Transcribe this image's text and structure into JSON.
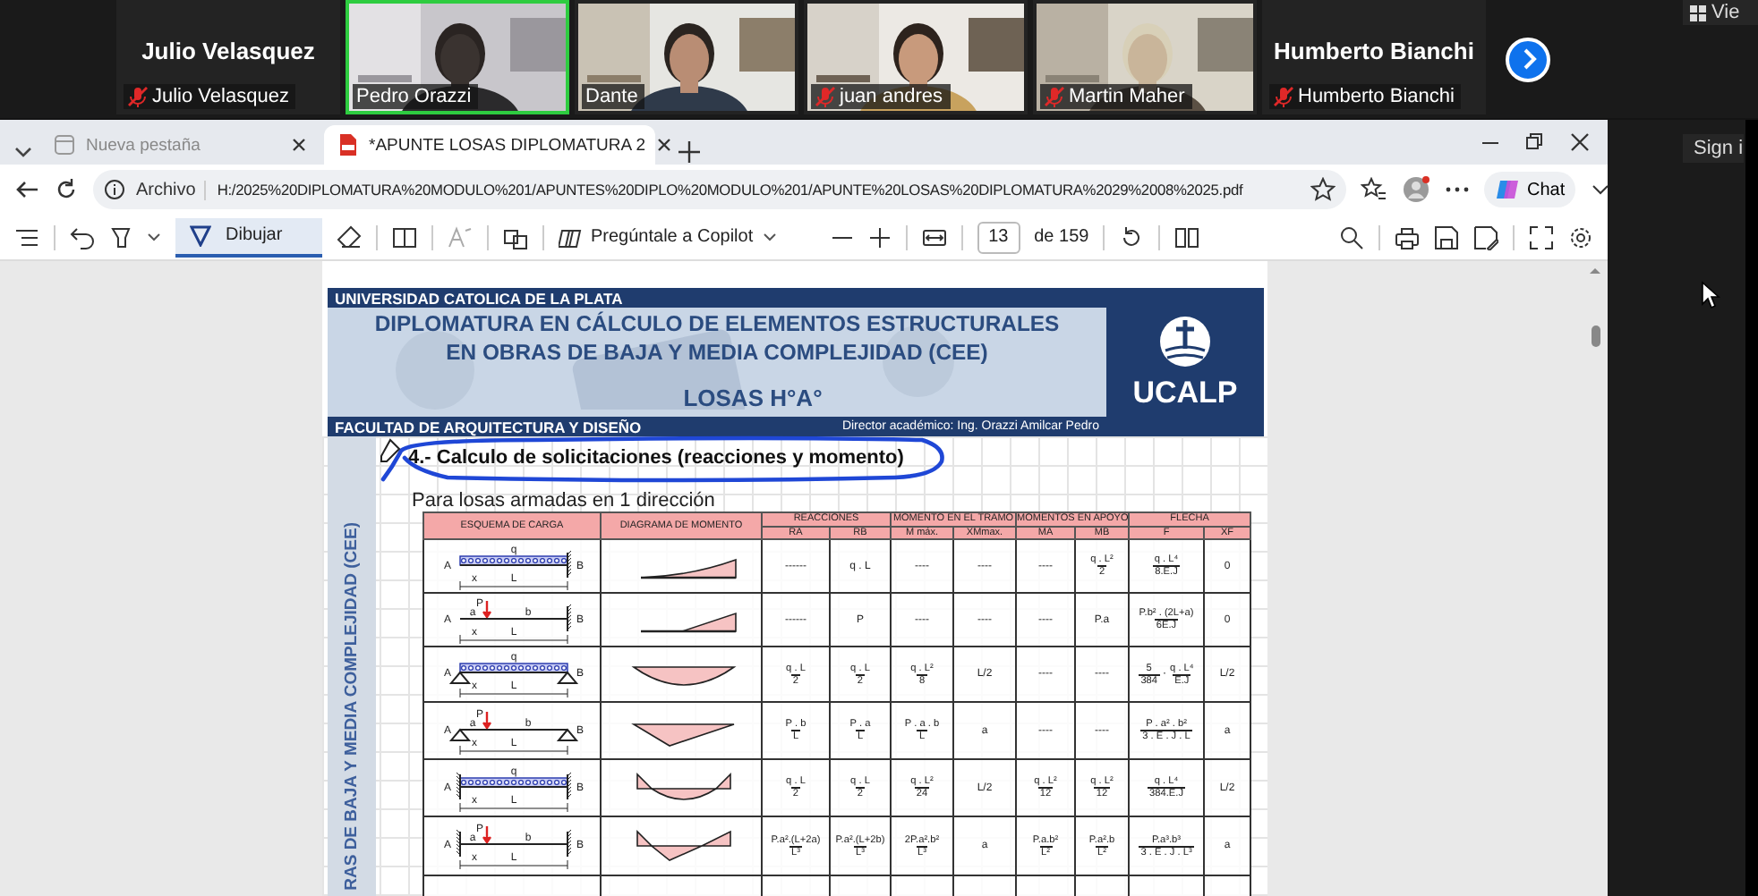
{
  "meeting": {
    "participants": [
      {
        "kind": "name",
        "tile_name": "Julio Velasquez",
        "name": "Julio Velasquez",
        "muted": true,
        "speaking": false
      },
      {
        "kind": "video",
        "name": "Pedro Orazzi",
        "muted": false,
        "speaking": true
      },
      {
        "kind": "video",
        "name": "Dante",
        "muted": false,
        "speaking": false
      },
      {
        "kind": "video",
        "name": "juan andres",
        "muted": true,
        "speaking": false
      },
      {
        "kind": "video",
        "name": "Martin Maher",
        "muted": true,
        "speaking": false
      },
      {
        "kind": "name",
        "tile_name": "Humberto Bianchi",
        "name": "Humberto Bianchi",
        "muted": true,
        "speaking": false
      }
    ],
    "view_label": "Vie",
    "sign_in_label": "Sign i"
  },
  "browser": {
    "tabs": [
      {
        "title": "Nueva pestaña",
        "selected": false
      },
      {
        "title": "*APUNTE LOSAS DIPLOMATURA 2",
        "selected": true
      }
    ],
    "address": {
      "prefix": "Archivo",
      "url": "H:/2025%20DIPLOMATURA%20MODULO%201/APUNTES%20DIPLO%20MODULO%201/APUNTE%20LOSAS%20DIPLOMATURA%2029%2008%2025.pdf"
    },
    "chat_label": "Chat",
    "toolbar": {
      "draw": {
        "label": "Dibujar",
        "selected": true
      },
      "copilot_label": "Pregúntale a Copilot",
      "page": "13",
      "page_count": "de 159"
    }
  },
  "document": {
    "university": "UNIVERSIDAD CATOLICA DE LA PLATA",
    "title_lines": [
      "DIPLOMATURA EN CÁLCULO DE ELEMENTOS ESTRUCTURALES",
      "EN OBRAS DE BAJA Y MEDIA COMPLEJIDAD (CEE)"
    ],
    "subject": "LOSAS H°A°",
    "faculty": "FACULTAD DE ARQUITECTURA Y DISEÑO",
    "director": "Director académico: Ing. Orazzi Amilcar Pedro",
    "logo_text": "UCALP",
    "side_text": "RAS DE BAJA Y MEDIA COMPLEJIDAD (CEE)",
    "heading": "4.- Calculo de solicitaciones (reacciones y momento)",
    "intro": "Para losas armadas en 1 dirección",
    "table": {
      "columns": [
        {
          "label": "ESQUEMA DE CARGA"
        },
        {
          "label": "DIAGRAMA DE MOMENTO"
        },
        {
          "label": "REACCIONES",
          "sub": [
            "RA",
            "RB"
          ]
        },
        {
          "label": "MOMENTO EN EL TRAMO",
          "sub": [
            "M máx.",
            "XMmax."
          ]
        },
        {
          "label": "MOMENTOS EN APOYO",
          "sub": [
            "MA",
            "MB"
          ]
        },
        {
          "label": "FLECHA",
          "sub": [
            "F",
            "XF"
          ]
        }
      ],
      "rows": [
        {
          "scheme": {
            "kind": "cantilever_udl",
            "load_label": "q",
            "ends": [
              "A",
              "B"
            ],
            "bottom_dims": [
              "x",
              "L"
            ]
          },
          "moment": {
            "kind": "cantilever_udl"
          },
          "values": [
            "------",
            "q . L",
            "----",
            "----",
            "----",
            [
              {
                "num": "q . L²",
                "den": "2"
              }
            ],
            [
              {
                "num": "q . L⁴",
                "den": "8.E.J"
              }
            ],
            "0"
          ]
        },
        {
          "scheme": {
            "kind": "cantilever_point",
            "load_label": "P",
            "ends": [
              "A",
              "B"
            ],
            "top_dims": [
              "a",
              "b"
            ],
            "bottom_dims": [
              "x",
              "L"
            ]
          },
          "moment": {
            "kind": "cantilever_point"
          },
          "values": [
            "------",
            "P",
            "----",
            "----",
            "----",
            "P.a",
            [
              {
                "num": "P.b² . (2L+a)",
                "den": "6E.J"
              }
            ],
            "0"
          ]
        },
        {
          "scheme": {
            "kind": "simple_udl",
            "load_label": "q",
            "ends": [
              "A",
              "B"
            ],
            "bottom_dims": [
              "x",
              "L"
            ]
          },
          "moment": {
            "kind": "simple_udl"
          },
          "values": [
            [
              {
                "num": "q . L",
                "den": "2"
              }
            ],
            [
              {
                "num": "q . L",
                "den": "2"
              }
            ],
            [
              {
                "num": "q . L²",
                "den": "8"
              }
            ],
            "L/2",
            "----",
            "----",
            [
              {
                "num": "5",
                "den": "384"
              },
              "·",
              {
                "num": "q . L⁴",
                "den": "E.J"
              }
            ],
            "L/2"
          ]
        },
        {
          "scheme": {
            "kind": "simple_point",
            "load_label": "P",
            "ends": [
              "A",
              "B"
            ],
            "top_dims": [
              "a",
              "b"
            ],
            "bottom_dims": [
              "x",
              "L"
            ]
          },
          "moment": {
            "kind": "simple_point"
          },
          "values": [
            [
              {
                "num": "P . b",
                "den": "L"
              }
            ],
            [
              {
                "num": "P . a",
                "den": "L"
              }
            ],
            [
              {
                "num": "P . a . b",
                "den": "L"
              }
            ],
            "a",
            "----",
            "----",
            [
              {
                "num": "P . a² . b²",
                "den": "3 . E . J . L"
              }
            ],
            "a"
          ]
        },
        {
          "scheme": {
            "kind": "fixed_udl",
            "load_label": "q",
            "ends": [
              "A",
              "B"
            ],
            "bottom_dims": [
              "x",
              "L"
            ]
          },
          "moment": {
            "kind": "fixed_udl"
          },
          "values": [
            [
              {
                "num": "q . L",
                "den": "2"
              }
            ],
            [
              {
                "num": "q . L",
                "den": "2"
              }
            ],
            [
              {
                "num": "q . L²",
                "den": "24"
              }
            ],
            "L/2",
            [
              {
                "num": "q . L²",
                "den": "12"
              }
            ],
            [
              {
                "num": "q . L²",
                "den": "12"
              }
            ],
            [
              {
                "num": "q . L⁴",
                "den": "384.E.J"
              }
            ],
            "L/2"
          ]
        },
        {
          "scheme": {
            "kind": "fixed_point",
            "load_label": "P",
            "ends": [
              "A",
              "B"
            ],
            "top_dims": [
              "a",
              "b"
            ],
            "bottom_dims": [
              "x",
              "L"
            ]
          },
          "moment": {
            "kind": "fixed_point"
          },
          "values": [
            [
              {
                "num": "P.a².(L+2a)",
                "den": "L³"
              }
            ],
            [
              {
                "num": "P.a².(L+2b)",
                "den": "L³"
              }
            ],
            [
              {
                "num": "2P.a².b²",
                "den": "L³"
              }
            ],
            "a",
            [
              {
                "num": "P.a.b²",
                "den": "L²"
              }
            ],
            [
              {
                "num": "P.a².b",
                "den": "L²"
              }
            ],
            [
              {
                "num": "P.a³.b³",
                "den": "3 . E . J . L³"
              }
            ],
            "a"
          ]
        }
      ]
    }
  }
}
